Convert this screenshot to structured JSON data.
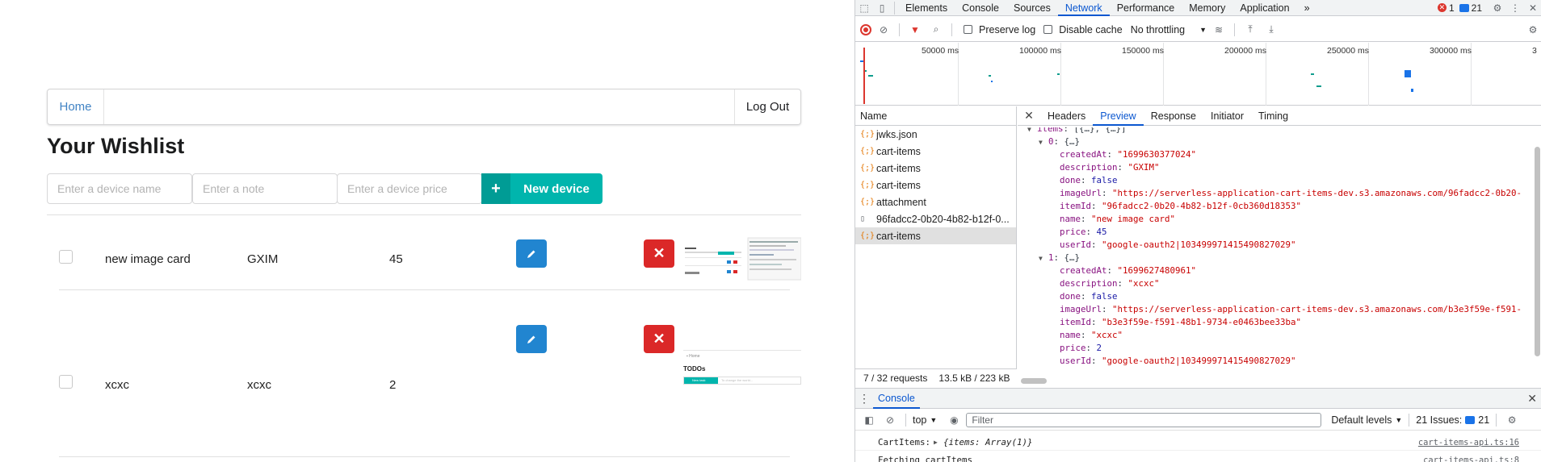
{
  "app": {
    "menu": {
      "home": "Home",
      "logout": "Log Out"
    },
    "title": "Your Wishlist",
    "inputs": {
      "name_placeholder": "Enter a device name",
      "note_placeholder": "Enter a note",
      "price_placeholder": "Enter a device price"
    },
    "new_button": {
      "icon": "plus-icon",
      "label": "New device"
    },
    "items": [
      {
        "name": "new image card",
        "note": "GXIM",
        "price": "45",
        "done": false
      },
      {
        "name": "xcxc",
        "note": "xcxc",
        "price": "2",
        "done": false
      }
    ],
    "thumb2": {
      "heading": "TODOs",
      "button": "New task",
      "placeholder": "To change the world..."
    },
    "colors": {
      "teal": "#00b5ad",
      "blue": "#2185d0",
      "red": "#db2828",
      "link": "#4183c4"
    }
  },
  "devtools": {
    "tabs": [
      "Elements",
      "Console",
      "Sources",
      "Network",
      "Performance",
      "Memory",
      "Application"
    ],
    "active_tab": "Network",
    "more": "»",
    "errors": "1",
    "messages": "21",
    "toolbar": {
      "preserve_log": "Preserve log",
      "disable_cache": "Disable cache",
      "throttling": "No throttling"
    },
    "timeline_ticks": [
      "50000 ms",
      "100000 ms",
      "150000 ms",
      "200000 ms",
      "250000 ms",
      "300000 ms",
      "3"
    ],
    "name_header": "Name",
    "requests": [
      {
        "name": "jwks.json",
        "type": "fetch"
      },
      {
        "name": "cart-items",
        "type": "fetch"
      },
      {
        "name": "cart-items",
        "type": "fetch"
      },
      {
        "name": "cart-items",
        "type": "fetch"
      },
      {
        "name": "attachment",
        "type": "fetch"
      },
      {
        "name": "96fadcc2-0b20-4b82-b12f-0...",
        "type": "document"
      },
      {
        "name": "cart-items",
        "type": "fetch",
        "selected": true
      }
    ],
    "status": {
      "requests": "7 / 32 requests",
      "size": "13.5 kB / 223 kB"
    },
    "detail_tabs": [
      "Headers",
      "Preview",
      "Response",
      "Initiator",
      "Timing"
    ],
    "active_detail_tab": "Preview",
    "preview": {
      "root_key": "items",
      "root_summary": "[{…}, {…}]",
      "items": [
        {
          "index": "0",
          "summary": "{…}",
          "createdAt": "\"1699630377024\"",
          "description": "\"GXIM\"",
          "done": "false",
          "imageUrl": "\"https://serverless-application-cart-items-dev.s3.amazonaws.com/96fadcc2-0b20-",
          "itemId": "\"96fadcc2-0b20-4b82-b12f-0cb360d18353\"",
          "name": "\"new image card\"",
          "price": "45",
          "userId": "\"google-oauth2|103499971415490827029\""
        },
        {
          "index": "1",
          "summary": "{…}",
          "createdAt": "\"1699627480961\"",
          "description": "\"xcxc\"",
          "done": "false",
          "imageUrl": "\"https://serverless-application-cart-items-dev.s3.amazonaws.com/b3e3f59e-f591-",
          "itemId": "\"b3e3f59e-f591-48b1-9734-e0463bee33ba\"",
          "name": "\"xcxc\"",
          "price": "2",
          "userId": "\"google-oauth2|103499971415490827029\""
        }
      ]
    },
    "console": {
      "title": "Console",
      "context": "top",
      "filter_placeholder": "Filter",
      "levels": "Default levels",
      "issues_label": "21 Issues:",
      "issues_count": "21",
      "lines": [
        {
          "text": "CartItems: ",
          "value": "{items: Array(1)}",
          "source": "cart-items-api.ts:16"
        },
        {
          "text": "Fetching cartItems",
          "value": "",
          "source": "cart-items-api.ts:8"
        }
      ]
    }
  }
}
